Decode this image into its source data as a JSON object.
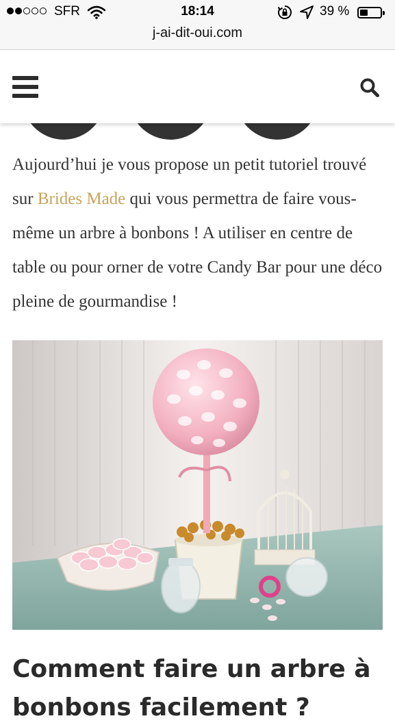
{
  "status_bar": {
    "carrier": "SFR",
    "time": "18:14",
    "battery": "39 %",
    "battery_level": 0.39,
    "signal_bars_filled": 2,
    "signal_bars_total": 5
  },
  "browser": {
    "url": "j-ai-dit-oui.com"
  },
  "header": {
    "menu_icon": "hamburger-menu-icon",
    "search_icon": "search-icon"
  },
  "intro": {
    "before_link": "Aujourd’hui je vous propose un petit tutoriel trouvé sur ",
    "link_text": "Brides Made",
    "after_link": " qui vous permettra de faire vous-même un arbre à bonbons ! A utiliser en centre de table ou pour orner de votre Candy Bar pour une déco pleine de gourmandise !"
  },
  "article": {
    "title": "Comment faire un arbre à bonbons facilement ?"
  },
  "colors": {
    "link": "#c9a25a",
    "text": "#333333",
    "title": "#2a2a2a",
    "header_icons": "#2b2b2b"
  }
}
